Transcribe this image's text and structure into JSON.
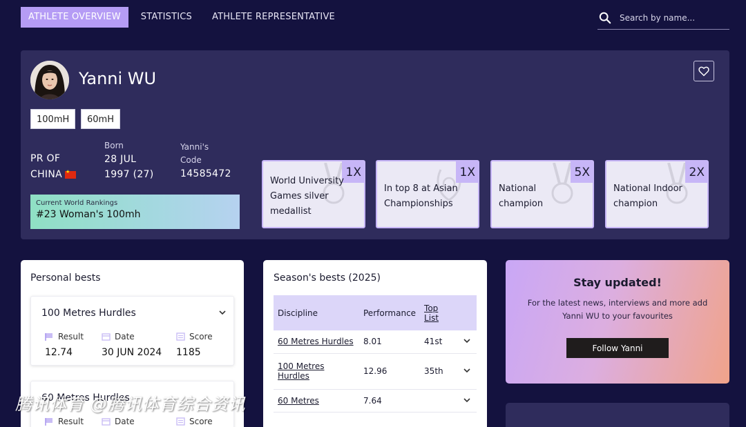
{
  "nav": {
    "tabs": [
      {
        "label": "ATHLETE OVERVIEW",
        "active": true
      },
      {
        "label": "STATISTICS",
        "active": false
      },
      {
        "label": "ATHLETE REPRESENTATIVE",
        "active": false
      }
    ],
    "search_placeholder": "Search by name..."
  },
  "athlete": {
    "name": "Yanni WU",
    "events": [
      "100mH",
      "60mH"
    ],
    "country_label": "PR OF",
    "country": "CHINA",
    "born_label": "Born",
    "born_date": "28 JUL",
    "born_year": "1997 (27)",
    "code_label_1": "Yanni's",
    "code_label_2": "Code",
    "code": "14585472",
    "ranking_label": "Current World Rankings",
    "ranking_value": "#23 Woman's 100mh"
  },
  "honours": [
    {
      "text": "World University Games silver medallist",
      "count": "1X"
    },
    {
      "text": "In top 8 at Asian Championships",
      "count": "1X"
    },
    {
      "text": "National champion",
      "count": "5X"
    },
    {
      "text": "National Indoor champion",
      "count": "2X"
    }
  ],
  "personal_bests": {
    "title": "Personal bests",
    "items": [
      {
        "discipline": "100 Metres Hurdles",
        "result_label": "Result",
        "result": "12.74",
        "date_label": "Date",
        "date": "30 JUN 2024",
        "score_label": "Score",
        "score": "1185"
      },
      {
        "discipline": "60 Metres Hurdles",
        "result_label": "Result",
        "date_label": "Date",
        "score_label": "Score"
      }
    ]
  },
  "season_bests": {
    "title": "Season's bests (2025)",
    "headers": {
      "discipline": "Discipline",
      "performance": "Performance",
      "toplist_1": "Top",
      "toplist_2": "List"
    },
    "rows": [
      {
        "discipline": "60 Metres Hurdles",
        "performance": "8.01",
        "toplist": "41st"
      },
      {
        "discipline_1": "100 Metres",
        "discipline_2": "Hurdles",
        "performance": "12.96",
        "toplist": "35th"
      },
      {
        "discipline": "60 Metres",
        "performance": "7.64",
        "toplist": ""
      }
    ]
  },
  "stay_updated": {
    "title": "Stay updated!",
    "text": "For the latest news, interviews and more add Yanni WU to your favourites",
    "button": "Follow Yanni"
  },
  "watermark": "腾讯体育 @腾讯体育综合资讯",
  "colors": {
    "background": "#14123f",
    "card": "#2f2c5c",
    "accent": "#b59cf5",
    "flag": "#de2910"
  }
}
